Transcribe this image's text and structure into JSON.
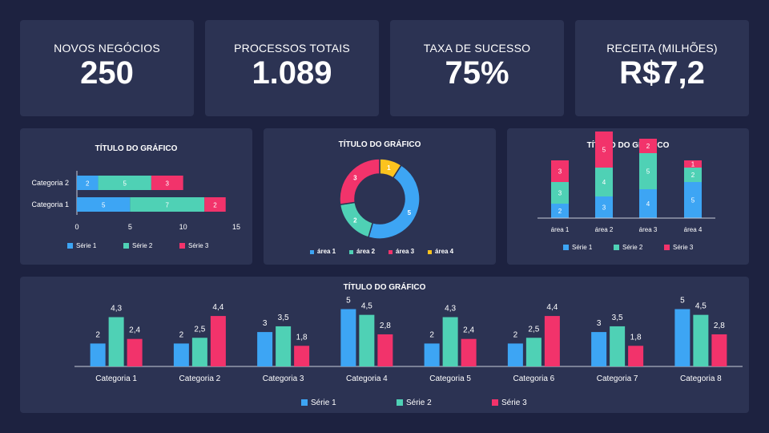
{
  "colors": {
    "serie1": "#3da5f4",
    "serie2": "#4fd1b5",
    "serie3": "#f2336b",
    "area4": "#fcc31e",
    "axis": "#c8ccd8"
  },
  "kpis": [
    {
      "label": "NOVOS NEGÓCIOS",
      "value": "250"
    },
    {
      "label": "PROCESSOS TOTAIS",
      "value": "1.089"
    },
    {
      "label": "TAXA DE SUCESSO",
      "value": "75%"
    },
    {
      "label": "RECEITA (MILHÕES)",
      "value": "R$7,2"
    }
  ],
  "chart_data": [
    {
      "type": "bar",
      "orientation": "horizontal",
      "stacked": true,
      "title": "TÍTULO DO GRÁFICO",
      "categories": [
        "Categoria 1",
        "Categoria 2"
      ],
      "series": [
        {
          "name": "Série 1",
          "values": [
            5,
            2
          ]
        },
        {
          "name": "Série 2",
          "values": [
            7,
            5
          ]
        },
        {
          "name": "Série 3",
          "values": [
            2,
            3
          ]
        }
      ],
      "xlim": [
        0,
        15
      ],
      "xticks": [
        "0",
        "5",
        "10",
        "15"
      ],
      "legend": "bottom"
    },
    {
      "type": "pie",
      "donut": true,
      "title": "TÍTULO DO GRÁFICO",
      "labels": [
        "área 1",
        "área 2",
        "área 3",
        "área 4"
      ],
      "values": [
        5,
        2,
        3,
        1
      ],
      "legend": "bottom"
    },
    {
      "type": "bar",
      "stacked": true,
      "title": "TÍTULO DO GRÁFICO",
      "categories": [
        "área 1",
        "área 2",
        "área 3",
        "área 4"
      ],
      "series": [
        {
          "name": "Série 1",
          "values": [
            2,
            3,
            4,
            5
          ]
        },
        {
          "name": "Série 2",
          "values": [
            3,
            4,
            5,
            2
          ]
        },
        {
          "name": "Série 3",
          "values": [
            3,
            5,
            2,
            1
          ]
        }
      ],
      "legend": "bottom"
    },
    {
      "type": "bar",
      "title": "TÍTULO DO GRÁFICO",
      "categories": [
        "Categoria 1",
        "Categoria 2",
        "Categoria 3",
        "Categoria 4",
        "Categoria 5",
        "Categoria 6",
        "Categoria 7",
        "Categoria 8"
      ],
      "series": [
        {
          "name": "Série 1",
          "values": [
            2,
            2,
            3,
            5,
            2,
            2,
            3,
            5
          ],
          "labels": [
            "2",
            "2",
            "3",
            "5",
            "2",
            "2",
            "3",
            "5"
          ]
        },
        {
          "name": "Série 2",
          "values": [
            4.3,
            2.5,
            3.5,
            4.5,
            4.3,
            2.5,
            3.5,
            4.5
          ],
          "labels": [
            "4,3",
            "2,5",
            "3,5",
            "4,5",
            "4,3",
            "2,5",
            "3,5",
            "4,5"
          ]
        },
        {
          "name": "Série 3",
          "values": [
            2.4,
            4.4,
            1.8,
            2.8,
            2.4,
            4.4,
            1.8,
            2.8
          ],
          "labels": [
            "2,4",
            "4,4",
            "1,8",
            "2,8",
            "2,4",
            "4,4",
            "1,8",
            "2,8"
          ]
        }
      ],
      "legend": "bottom"
    }
  ]
}
